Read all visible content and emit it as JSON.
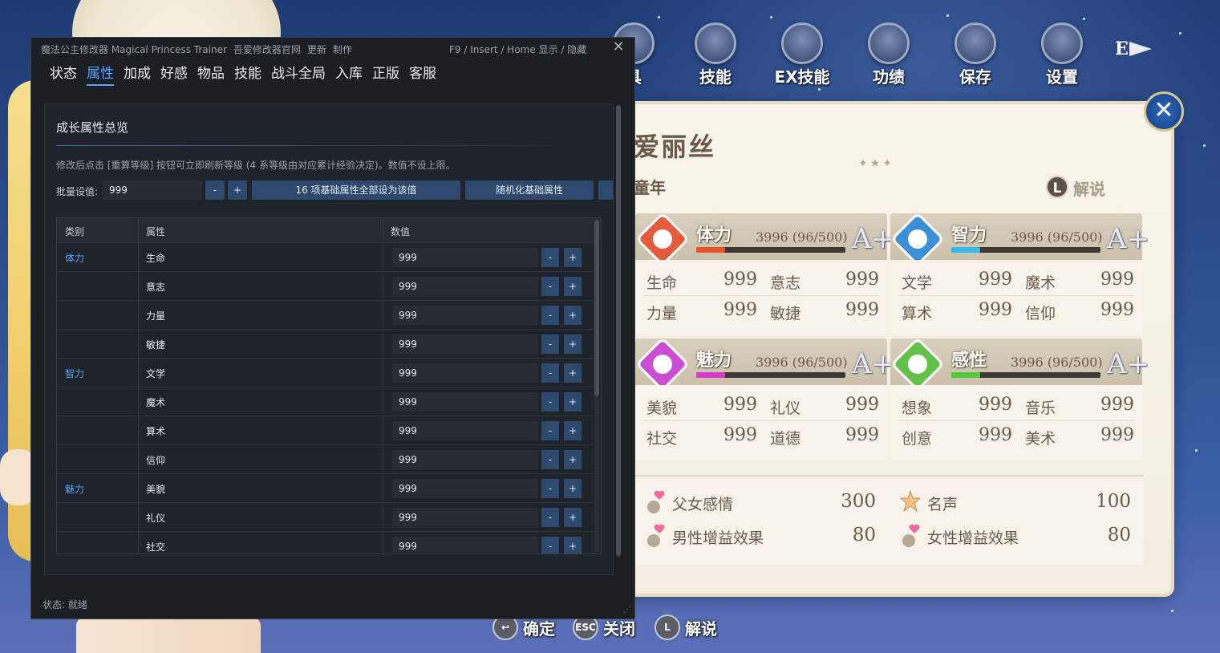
{
  "game": {
    "top_menu": [
      {
        "label": "具",
        "icon": "bag-icon"
      },
      {
        "label": "技能",
        "icon": "star-emblem-icon"
      },
      {
        "label": "EX技能",
        "icon": "orb-icon"
      },
      {
        "label": "功绩",
        "icon": "trophy-icon"
      },
      {
        "label": "保存",
        "icon": "card-wing-icon"
      },
      {
        "label": "设置",
        "icon": "gear-icon"
      }
    ],
    "e_key": "E",
    "character": {
      "name": "爱丽丝",
      "stage": "童年",
      "explain_key": "L",
      "explain_label": "解说"
    },
    "stat_groups": [
      {
        "key": "physical",
        "title": "体力",
        "total": "3996 (96/500)",
        "grade": "A+",
        "progress": 0.192,
        "bar_color": "#e8532a",
        "icon_color": "#e65a3c",
        "stats": [
          {
            "name": "生命",
            "value": "999"
          },
          {
            "name": "意志",
            "value": "999"
          },
          {
            "name": "力量",
            "value": "999"
          },
          {
            "name": "敏捷",
            "value": "999"
          }
        ]
      },
      {
        "key": "intellect",
        "title": "智力",
        "total": "3996 (96/500)",
        "grade": "A+",
        "progress": 0.192,
        "bar_color": "#35b9e8",
        "icon_color": "#3a8fd6",
        "stats": [
          {
            "name": "文学",
            "value": "999"
          },
          {
            "name": "魔术",
            "value": "999"
          },
          {
            "name": "算术",
            "value": "999"
          },
          {
            "name": "信仰",
            "value": "999"
          }
        ]
      },
      {
        "key": "charm",
        "title": "魅力",
        "total": "3996 (96/500)",
        "grade": "A+",
        "progress": 0.192,
        "bar_color": "#d83ad0",
        "icon_color": "#c94ed4",
        "stats": [
          {
            "name": "美貌",
            "value": "999"
          },
          {
            "name": "礼仪",
            "value": "999"
          },
          {
            "name": "社交",
            "value": "999"
          },
          {
            "name": "道德",
            "value": "999"
          }
        ]
      },
      {
        "key": "sense",
        "title": "感性",
        "total": "3996 (96/500)",
        "grade": "A+",
        "progress": 0.192,
        "bar_color": "#56c93a",
        "icon_color": "#62c24a",
        "stats": [
          {
            "name": "想象",
            "value": "999"
          },
          {
            "name": "音乐",
            "value": "999"
          },
          {
            "name": "创意",
            "value": "999"
          },
          {
            "name": "美术",
            "value": "999"
          }
        ]
      }
    ],
    "extras": [
      {
        "label": "父女感情",
        "value": "300",
        "icon": "heart-icon"
      },
      {
        "label": "名声",
        "value": "100",
        "icon": "star-badge-icon"
      },
      {
        "label": "男性增益效果",
        "value": "80",
        "icon": "heart-person-icon"
      },
      {
        "label": "女性增益效果",
        "value": "80",
        "icon": "heart-person-icon"
      }
    ],
    "hints": [
      {
        "key": "↩",
        "label": "确定"
      },
      {
        "key": "ESC",
        "label": "关闭"
      },
      {
        "key": "L",
        "label": "解说"
      }
    ]
  },
  "trainer": {
    "title_parts": [
      "魔法公主修改器 Magical Princess Trainer",
      "吾爱修改器官网",
      "更新",
      "制作"
    ],
    "hotkey": "F9 / Insert / Home  显示 / 隐藏",
    "close": "✕",
    "tabs": [
      "状态",
      "属性",
      "加成",
      "好感",
      "物品",
      "技能",
      "战斗全局",
      "入库",
      "正版",
      "客服"
    ],
    "active_tab": "属性",
    "section_title": "成长属性总览",
    "note": "修改后点击 [重算等级] 按钮可立即刷新等级 (4 系等级由对应累计经验决定)。数值不设上限。",
    "bulk_label": "批量设值:",
    "bulk_value": "999",
    "minus": "-",
    "plus": "+",
    "btn_set_all": "16 项基础属性全部设为该值",
    "btn_random": "随机化基础属性",
    "columns": [
      "类别",
      "属性",
      "数值"
    ],
    "rows": [
      {
        "category": "体力",
        "attr": "生命",
        "value": "999"
      },
      {
        "category": "",
        "attr": "意志",
        "value": "999"
      },
      {
        "category": "",
        "attr": "力量",
        "value": "999"
      },
      {
        "category": "",
        "attr": "敏捷",
        "value": "999"
      },
      {
        "category": "智力",
        "attr": "文学",
        "value": "999"
      },
      {
        "category": "",
        "attr": "魔术",
        "value": "999"
      },
      {
        "category": "",
        "attr": "算术",
        "value": "999"
      },
      {
        "category": "",
        "attr": "信仰",
        "value": "999"
      },
      {
        "category": "魅力",
        "attr": "美貌",
        "value": "999"
      },
      {
        "category": "",
        "attr": "礼仪",
        "value": "999"
      },
      {
        "category": "",
        "attr": "社交",
        "value": "999"
      }
    ],
    "status": "状态: 就绪"
  }
}
